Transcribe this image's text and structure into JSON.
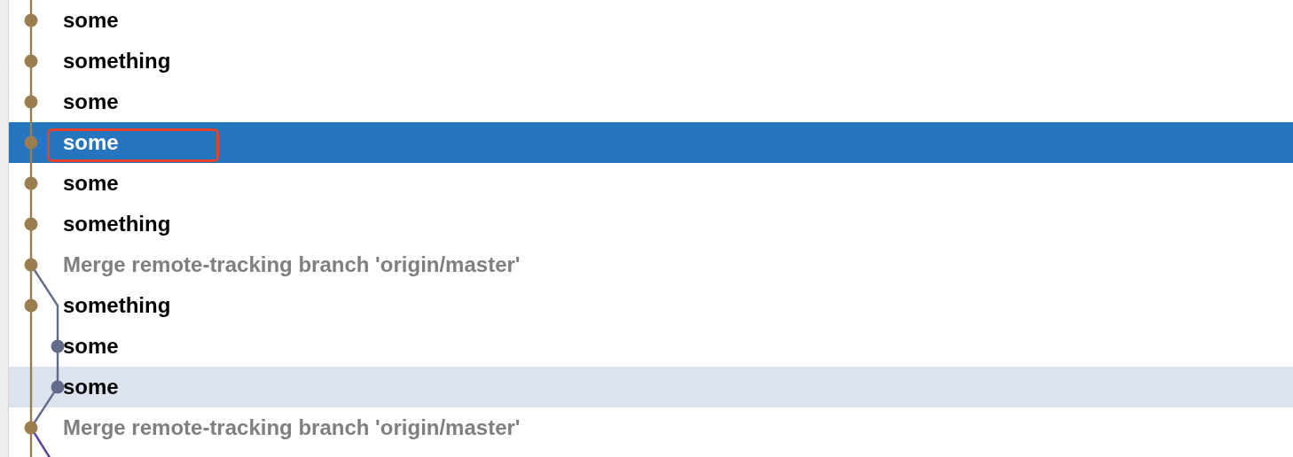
{
  "commits": [
    {
      "message": "some",
      "kind": "commit",
      "selected": false,
      "hovered": false,
      "outlined": false
    },
    {
      "message": "something",
      "kind": "commit",
      "selected": false,
      "hovered": false,
      "outlined": false
    },
    {
      "message": "some",
      "kind": "commit",
      "selected": false,
      "hovered": false,
      "outlined": false
    },
    {
      "message": "some",
      "kind": "commit",
      "selected": true,
      "hovered": false,
      "outlined": true
    },
    {
      "message": "some",
      "kind": "commit",
      "selected": false,
      "hovered": false,
      "outlined": false
    },
    {
      "message": "something",
      "kind": "commit",
      "selected": false,
      "hovered": false,
      "outlined": false
    },
    {
      "message": "Merge remote-tracking branch 'origin/master'",
      "kind": "merge",
      "selected": false,
      "hovered": false,
      "outlined": false
    },
    {
      "message": "something",
      "kind": "commit",
      "selected": false,
      "hovered": false,
      "outlined": false
    },
    {
      "message": "some",
      "kind": "sidecommit",
      "selected": false,
      "hovered": false,
      "outlined": false
    },
    {
      "message": "some",
      "kind": "sidecommit",
      "selected": false,
      "hovered": true,
      "outlined": false
    },
    {
      "message": "Merge remote-tracking branch 'origin/master'",
      "kind": "merge",
      "selected": false,
      "hovered": false,
      "outlined": false
    }
  ]
}
